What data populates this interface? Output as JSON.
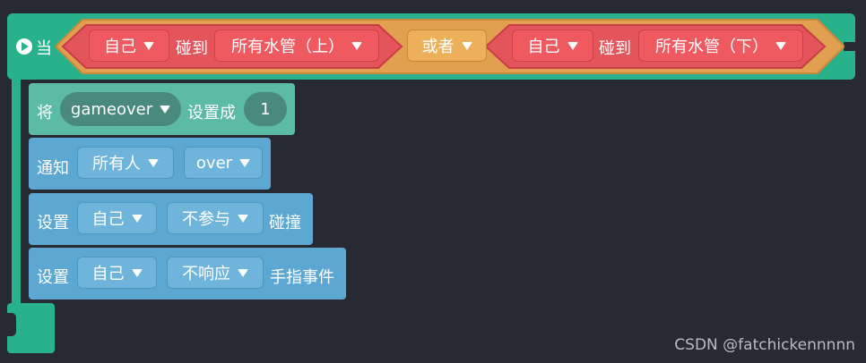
{
  "hat": {
    "label": "当",
    "operator": "或者",
    "left_condition": {
      "subject": "自己",
      "verb": "碰到",
      "target": "所有水管（上）"
    },
    "right_condition": {
      "subject": "自己",
      "verb": "碰到",
      "target": "所有水管（下）"
    }
  },
  "blocks": [
    {
      "kind": "set_var",
      "prefix": "将",
      "variable": "gameover",
      "middle": "设置成",
      "value": "1"
    },
    {
      "kind": "broadcast",
      "prefix": "通知",
      "target": "所有人",
      "message": "over"
    },
    {
      "kind": "set_collision",
      "prefix": "设置",
      "subject": "自己",
      "option": "不参与",
      "suffix": "碰撞"
    },
    {
      "kind": "set_touch",
      "prefix": "设置",
      "subject": "自己",
      "option": "不响应",
      "suffix": "手指事件"
    }
  ],
  "watermark": "CSDN @fatchickennnnn",
  "colors": {
    "background": "#272a32",
    "event_green": "#28b28b",
    "condition_red": "#ef5a60",
    "operator_orange": "#e0a04f",
    "data_teal": "#5cbba5",
    "action_blue": "#5da8d2"
  }
}
